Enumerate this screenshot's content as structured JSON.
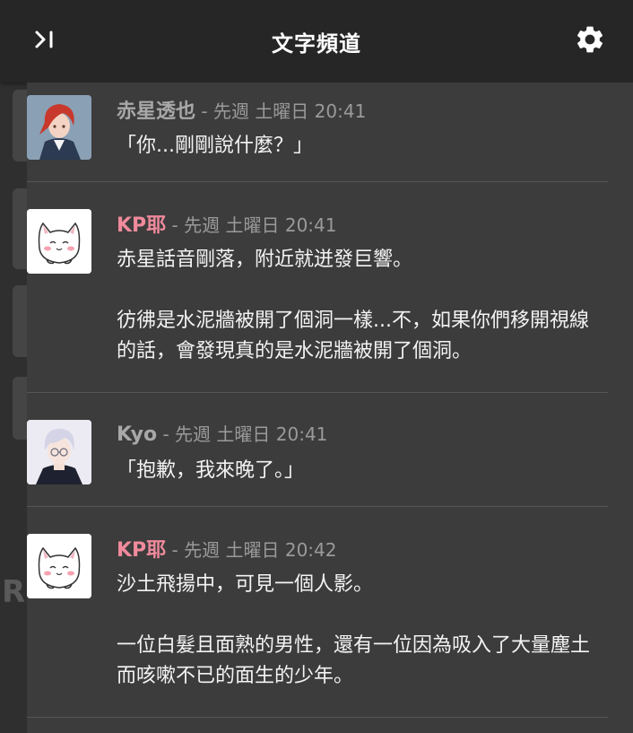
{
  "header": {
    "title": "文字頻道",
    "collapse_icon": "collapse-right-icon",
    "settings_icon": "gear-icon"
  },
  "colors": {
    "header_bg": "#262626",
    "feed_bg": "#3c3c3c",
    "name_gray": "#9a9a9a",
    "name_pink": "#f08a9c"
  },
  "messages": [
    {
      "author": "赤星透也",
      "separator": " - ",
      "timestamp": "先週 土曜日 20:41",
      "avatar": "red-haired-character-avatar",
      "author_color": "#a8a8a8",
      "paragraphs": [
        "「你...剛剛說什麼？」"
      ]
    },
    {
      "author": "KP耶",
      "separator": " - ",
      "timestamp": "先週 土曜日 20:41",
      "avatar": "white-cat-avatar",
      "author_color": "#f08a9c",
      "paragraphs": [
        "赤星話音剛落，附近就迸發巨響。",
        "彷彿是水泥牆被開了個洞一樣...不，如果你們移開視線的話，會發現真的是水泥牆被開了個洞。"
      ]
    },
    {
      "author": "Kyo",
      "separator": " - ",
      "timestamp": "先週 土曜日 20:41",
      "avatar": "white-haired-character-avatar",
      "author_color": "#a8a8a8",
      "paragraphs": [
        "「抱歉，我來晚了。」"
      ]
    },
    {
      "author": "KP耶",
      "separator": " - ",
      "timestamp": "先週 土曜日 20:42",
      "avatar": "white-cat-avatar",
      "author_color": "#f08a9c",
      "paragraphs": [
        "沙土飛揚中，可見一個人影。",
        "一位白髮且面熟的男性，還有一位因為吸入了大量塵土而咳嗽不已的面生的少年。"
      ]
    }
  ],
  "background_letter": "R"
}
